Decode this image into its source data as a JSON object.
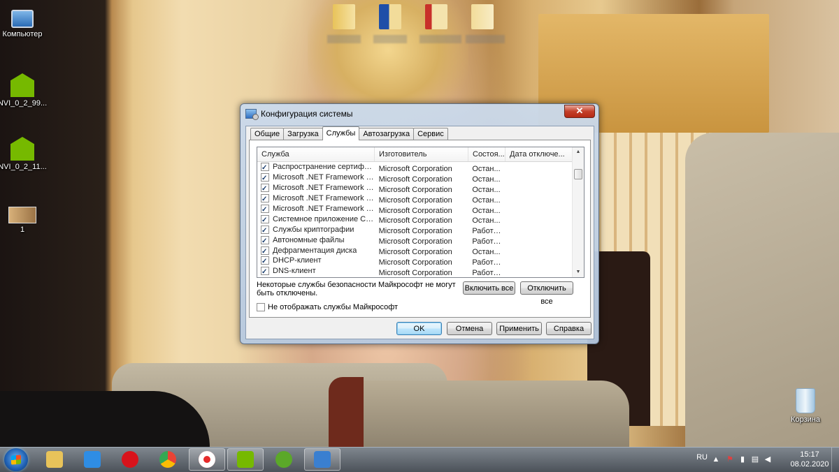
{
  "desktop": {
    "icons": [
      {
        "label": "Компьютер",
        "icon": "computer-icon"
      },
      {
        "label": "NVI_0_2_99...",
        "icon": "nvidia-installer-icon"
      },
      {
        "label": "NVI_0_2_11...",
        "icon": "nvidia-installer-icon"
      },
      {
        "label": "1",
        "icon": "image-file-icon"
      },
      {
        "label": "Корзина",
        "icon": "recycle-bin-icon"
      }
    ]
  },
  "dialog": {
    "title": "Конфигурация системы",
    "close_label": "✕",
    "tabs": [
      {
        "label": "Общие",
        "active": false
      },
      {
        "label": "Загрузка",
        "active": false
      },
      {
        "label": "Службы",
        "active": true
      },
      {
        "label": "Автозагрузка",
        "active": false
      },
      {
        "label": "Сервис",
        "active": false
      }
    ],
    "columns": [
      "Служба",
      "Изготовитель",
      "Состоя...",
      "Дата отключе..."
    ],
    "services": [
      {
        "name": "Распространение сертификата",
        "maker": "Microsoft Corporation",
        "status": "Остан...",
        "date": "",
        "checked": true
      },
      {
        "name": "Microsoft .NET Framework NGEN...",
        "maker": "Microsoft Corporation",
        "status": "Остан...",
        "date": "",
        "checked": true
      },
      {
        "name": "Microsoft .NET Framework NGEN...",
        "maker": "Microsoft Corporation",
        "status": "Остан...",
        "date": "",
        "checked": true
      },
      {
        "name": "Microsoft .NET Framework NGEN...",
        "maker": "Microsoft Corporation",
        "status": "Остан...",
        "date": "",
        "checked": true
      },
      {
        "name": "Microsoft .NET Framework NGEN...",
        "maker": "Microsoft Corporation",
        "status": "Остан...",
        "date": "",
        "checked": true
      },
      {
        "name": "Системное приложение COM+",
        "maker": "Microsoft Corporation",
        "status": "Остан...",
        "date": "",
        "checked": true
      },
      {
        "name": "Службы криптографии",
        "maker": "Microsoft Corporation",
        "status": "Работает",
        "date": "",
        "checked": true
      },
      {
        "name": "Автономные файлы",
        "maker": "Microsoft Corporation",
        "status": "Работает",
        "date": "",
        "checked": true
      },
      {
        "name": "Дефрагментация диска",
        "maker": "Microsoft Corporation",
        "status": "Остан...",
        "date": "",
        "checked": true
      },
      {
        "name": "DHCP-клиент",
        "maker": "Microsoft Corporation",
        "status": "Работает",
        "date": "",
        "checked": true
      },
      {
        "name": "DNS-клиент",
        "maker": "Microsoft Corporation",
        "status": "Работает",
        "date": "",
        "checked": true
      }
    ],
    "note": "Некоторые службы безопасности Майкрософт не могут быть отключены.",
    "enable_all": "Включить все",
    "disable_all": "Отключить все",
    "hide_ms_label": "Не отображать службы Майкрософт",
    "hide_ms_checked": false,
    "ok": "OK",
    "cancel": "Отмена",
    "apply": "Применить",
    "help": "Справка"
  },
  "taskbar": {
    "pinned": [
      {
        "icon": "explorer-icon",
        "color": "#e8c35a",
        "running": false
      },
      {
        "icon": "media-player-icon",
        "color": "#2f8de4",
        "running": false
      },
      {
        "icon": "opera-icon",
        "color": "#d8131b",
        "running": false
      },
      {
        "icon": "chrome-icon",
        "color": "#34a853",
        "running": false
      },
      {
        "icon": "yandex-browser-icon",
        "color": "#ffffff",
        "running": true
      },
      {
        "icon": "nvidia-installer-icon",
        "color": "#76b900",
        "running": true
      },
      {
        "icon": "utorrent-icon",
        "color": "#5ba829",
        "running": false
      },
      {
        "icon": "msconfig-icon",
        "color": "#3a7fd0",
        "running": true
      }
    ],
    "tray": {
      "language": "RU",
      "time": "15:17",
      "date": "08.02.2020"
    }
  }
}
